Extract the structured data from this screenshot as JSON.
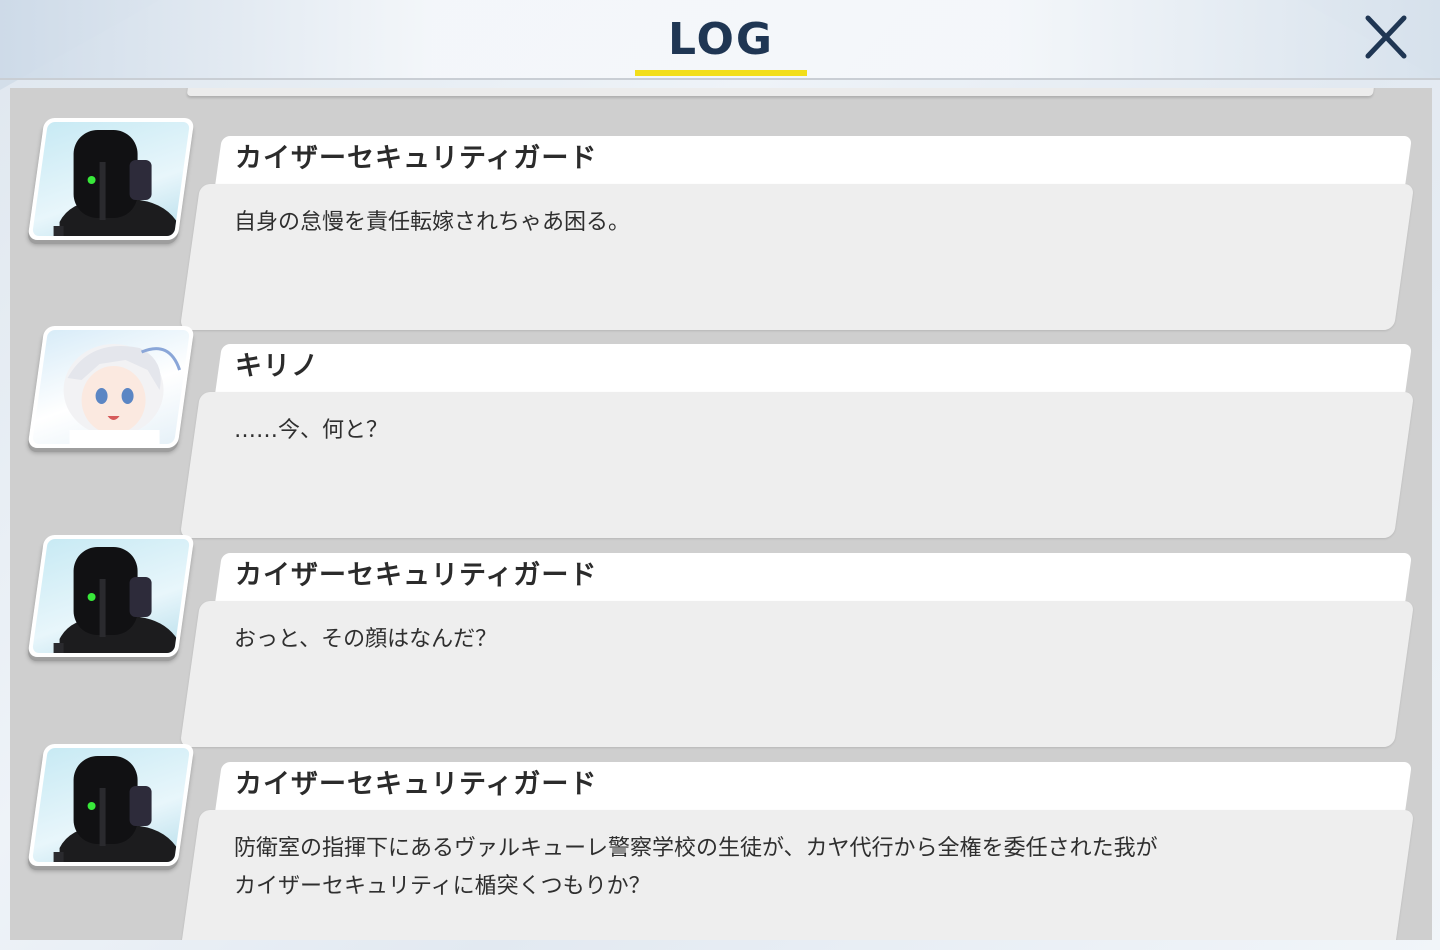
{
  "header": {
    "title": "LOG",
    "close_icon": "close-x-icon",
    "accent": "#f2de1a",
    "title_color": "#1f3653"
  },
  "entries": [
    {
      "speaker": "カイザーセキュリティガード",
      "text": "自身の怠慢を責任転嫁されちゃあ困る。",
      "avatar": "robot-guard-avatar"
    },
    {
      "speaker": "キリノ",
      "text": "……今、何と？",
      "avatar": "kirino-avatar"
    },
    {
      "speaker": "カイザーセキュリティガード",
      "text": "おっと、その顔はなんだ？",
      "avatar": "robot-guard-avatar"
    },
    {
      "speaker": "カイザーセキュリティガード",
      "text": "防衛室の指揮下にあるヴァルキューレ警察学校の生徒が、カヤ代行から全権を委任された我が\nカイザーセキュリティに楯突くつもりか？",
      "avatar": "robot-guard-avatar"
    }
  ]
}
